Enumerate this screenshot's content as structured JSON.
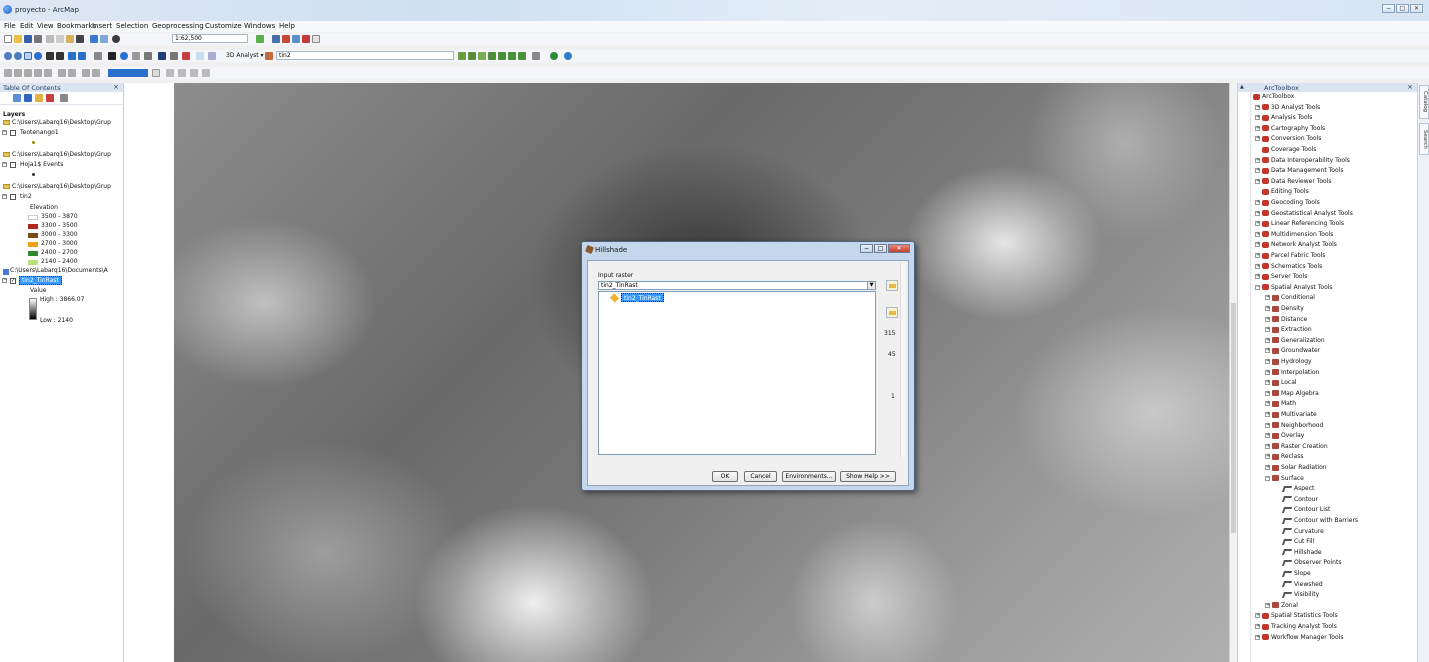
{
  "window": {
    "title": "proyecto - ArcMap",
    "controls": [
      "−",
      "□",
      "✕"
    ]
  },
  "menu": [
    "File",
    "Edit",
    "View",
    "Bookmarks",
    "Insert",
    "Selection",
    "Geoprocessing",
    "Customize",
    "Windows",
    "Help"
  ],
  "toolbar": {
    "scale": "1:62,500",
    "analyst_label": "3D Analyst ▾",
    "layer_select": "tin2"
  },
  "toc": {
    "title": "Table Of Contents",
    "layers_label": "Layers",
    "paths": {
      "p1": "C:\\Users\\Labarq16\\Desktop\\Grup",
      "p2": "C:\\Users\\Labarq16\\Desktop\\Grup",
      "p3": "C:\\Users\\Labarq16\\Desktop\\Grup",
      "p4": "C:\\Users\\Labarq16\\Documents\\A"
    },
    "layer_teotenango": "Teotenango1",
    "layer_hoja": "Hoja1$ Events",
    "layer_tin2": "tin2",
    "elevation_label": "Elevation",
    "classes": [
      {
        "label": "3500 - 3870",
        "color": "#ffffff"
      },
      {
        "label": "3300 - 3500",
        "color": "#b3261e"
      },
      {
        "label": "3000 - 3300",
        "color": "#7a4a12"
      },
      {
        "label": "2700 - 3000",
        "color": "#f0a21c"
      },
      {
        "label": "2400 - 2700",
        "color": "#2f8a2f"
      },
      {
        "label": "2140 - 2400",
        "color": "#b8e27a"
      }
    ],
    "layer_raster": "tin2_TinRast",
    "value_label": "Value",
    "high_label": "High : 3866.07",
    "low_label": "Low : 2140"
  },
  "dialog": {
    "title": "Hillshade",
    "input_label": "Input raster",
    "input_value": "tin2_TinRast",
    "list_item": "tin2_TinRast",
    "azimuth": "315",
    "altitude": "45",
    "z_factor": "1",
    "buttons": {
      "ok": "OK",
      "cancel": "Cancel",
      "env": "Environments...",
      "help": "Show Help >>"
    }
  },
  "toolbox": {
    "title": "ArcToolbox",
    "root": "ArcToolbox",
    "toolsets_top": [
      "3D Analyst Tools",
      "Analysis Tools",
      "Cartography Tools",
      "Conversion Tools",
      "Coverage Tools",
      "Data Interoperability Tools",
      "Data Management Tools",
      "Data Reviewer Tools",
      "Editing Tools",
      "Geocoding Tools",
      "Geostatistical Analyst Tools",
      "Linear Referencing Tools",
      "Multidimension Tools",
      "Network Analyst Tools",
      "Parcel Fabric Tools",
      "Schematics Tools",
      "Server Tools",
      "Spatial Analyst Tools"
    ],
    "spatial_sub": [
      "Conditional",
      "Density",
      "Distance",
      "Extraction",
      "Generalization",
      "Groundwater",
      "Hydrology",
      "Interpolation",
      "Local",
      "Map Algebra",
      "Math",
      "Multivariate",
      "Neighborhood",
      "Overlay",
      "Raster Creation",
      "Reclass",
      "Solar Radiation",
      "Surface"
    ],
    "surface_tools": [
      "Aspect",
      "Contour",
      "Contour List",
      "Contour with Barriers",
      "Curvature",
      "Cut Fill",
      "Hillshade",
      "Observer Points",
      "Slope",
      "Viewshed",
      "Visibility"
    ],
    "zonal": "Zonal",
    "toolsets_bottom": [
      "Spatial Statistics Tools",
      "Tracking Analyst Tools",
      "Workflow Manager Tools"
    ]
  },
  "side_tabs": [
    "Catalog",
    "Search"
  ]
}
